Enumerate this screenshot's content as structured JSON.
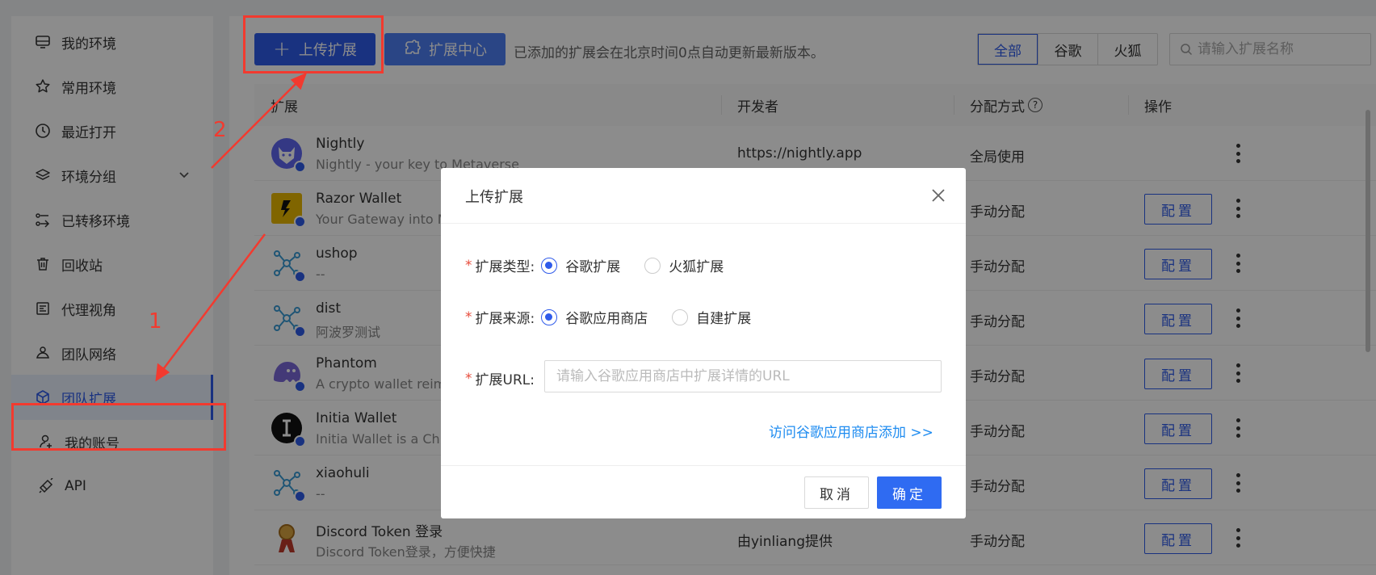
{
  "sidebar": {
    "items": [
      {
        "label": "我的环境",
        "icon": "desktop-icon"
      },
      {
        "label": "常用环境",
        "icon": "star-icon"
      },
      {
        "label": "最近打开",
        "icon": "clock-icon"
      },
      {
        "label": "环境分组",
        "icon": "layers-icon"
      },
      {
        "label": "已转移环境",
        "icon": "transfer-icon"
      },
      {
        "label": "回收站",
        "icon": "trash-icon"
      },
      {
        "label": "代理视角",
        "icon": "proxy-icon"
      },
      {
        "label": "团队网络",
        "icon": "network-icon"
      },
      {
        "label": "团队扩展",
        "icon": "cube-icon"
      },
      {
        "label": "我的账号",
        "icon": "user-icon"
      },
      {
        "label": "API",
        "icon": "api-icon"
      }
    ],
    "active": "团队扩展"
  },
  "toolbar": {
    "upload_label": "上传扩展",
    "center_label": "扩展中心",
    "hint": "已添加的扩展会在北京时间0点自动更新最新版本。",
    "filters": [
      "全部",
      "谷歌",
      "火狐"
    ],
    "active_filter": "全部",
    "search_placeholder": "请输入扩展名称"
  },
  "table": {
    "headers": [
      "扩展",
      "开发者",
      "分配方式",
      "操作"
    ],
    "config_label": "配置",
    "rows": [
      {
        "name": "Nightly",
        "desc": "Nightly - your key to Metaverse",
        "dev": "https://nightly.app",
        "dist": "全局使用",
        "has_config": false
      },
      {
        "name": "Razor Wallet",
        "desc": "Your Gateway into M",
        "dev": "",
        "dist": "手动分配",
        "has_config": true
      },
      {
        "name": "ushop",
        "desc": "--",
        "dev": "",
        "dist": "手动分配",
        "has_config": true
      },
      {
        "name": "dist",
        "desc": "阿波罗测试",
        "dev": "",
        "dist": "手动分配",
        "has_config": true
      },
      {
        "name": "Phantom",
        "desc": "A crypto wallet reim",
        "dev": "",
        "dist": "手动分配",
        "has_config": true
      },
      {
        "name": "Initia Wallet",
        "desc": "Initia Wallet is a Chr",
        "dev": "",
        "dist": "手动分配",
        "has_config": true
      },
      {
        "name": "xiaohuli",
        "desc": "--",
        "dev": "",
        "dist": "手动分配",
        "has_config": true
      },
      {
        "name": "Discord Token 登录",
        "desc": "Discord Token登录，方便快捷",
        "dev": "由yinliang提供",
        "dist": "手动分配",
        "has_config": true
      }
    ]
  },
  "modal": {
    "title": "上传扩展",
    "type_label": "扩展类型:",
    "type_options": [
      "谷歌扩展",
      "火狐扩展"
    ],
    "type_selected": "谷歌扩展",
    "source_label": "扩展来源:",
    "source_options": [
      "谷歌应用商店",
      "自建扩展"
    ],
    "source_selected": "谷歌应用商店",
    "url_label": "扩展URL:",
    "url_placeholder": "请输入谷歌应用商店中扩展详情的URL",
    "url_value": "",
    "visit_link": "访问谷歌应用商店添加 >>",
    "cancel_label": "取消",
    "ok_label": "确定"
  },
  "annotations": {
    "step1": "1",
    "step2": "2",
    "color": "#f23a2f"
  },
  "colors": {
    "accent": "#2f5bea",
    "link": "#1f8cf0",
    "required": "#e74c3c"
  }
}
